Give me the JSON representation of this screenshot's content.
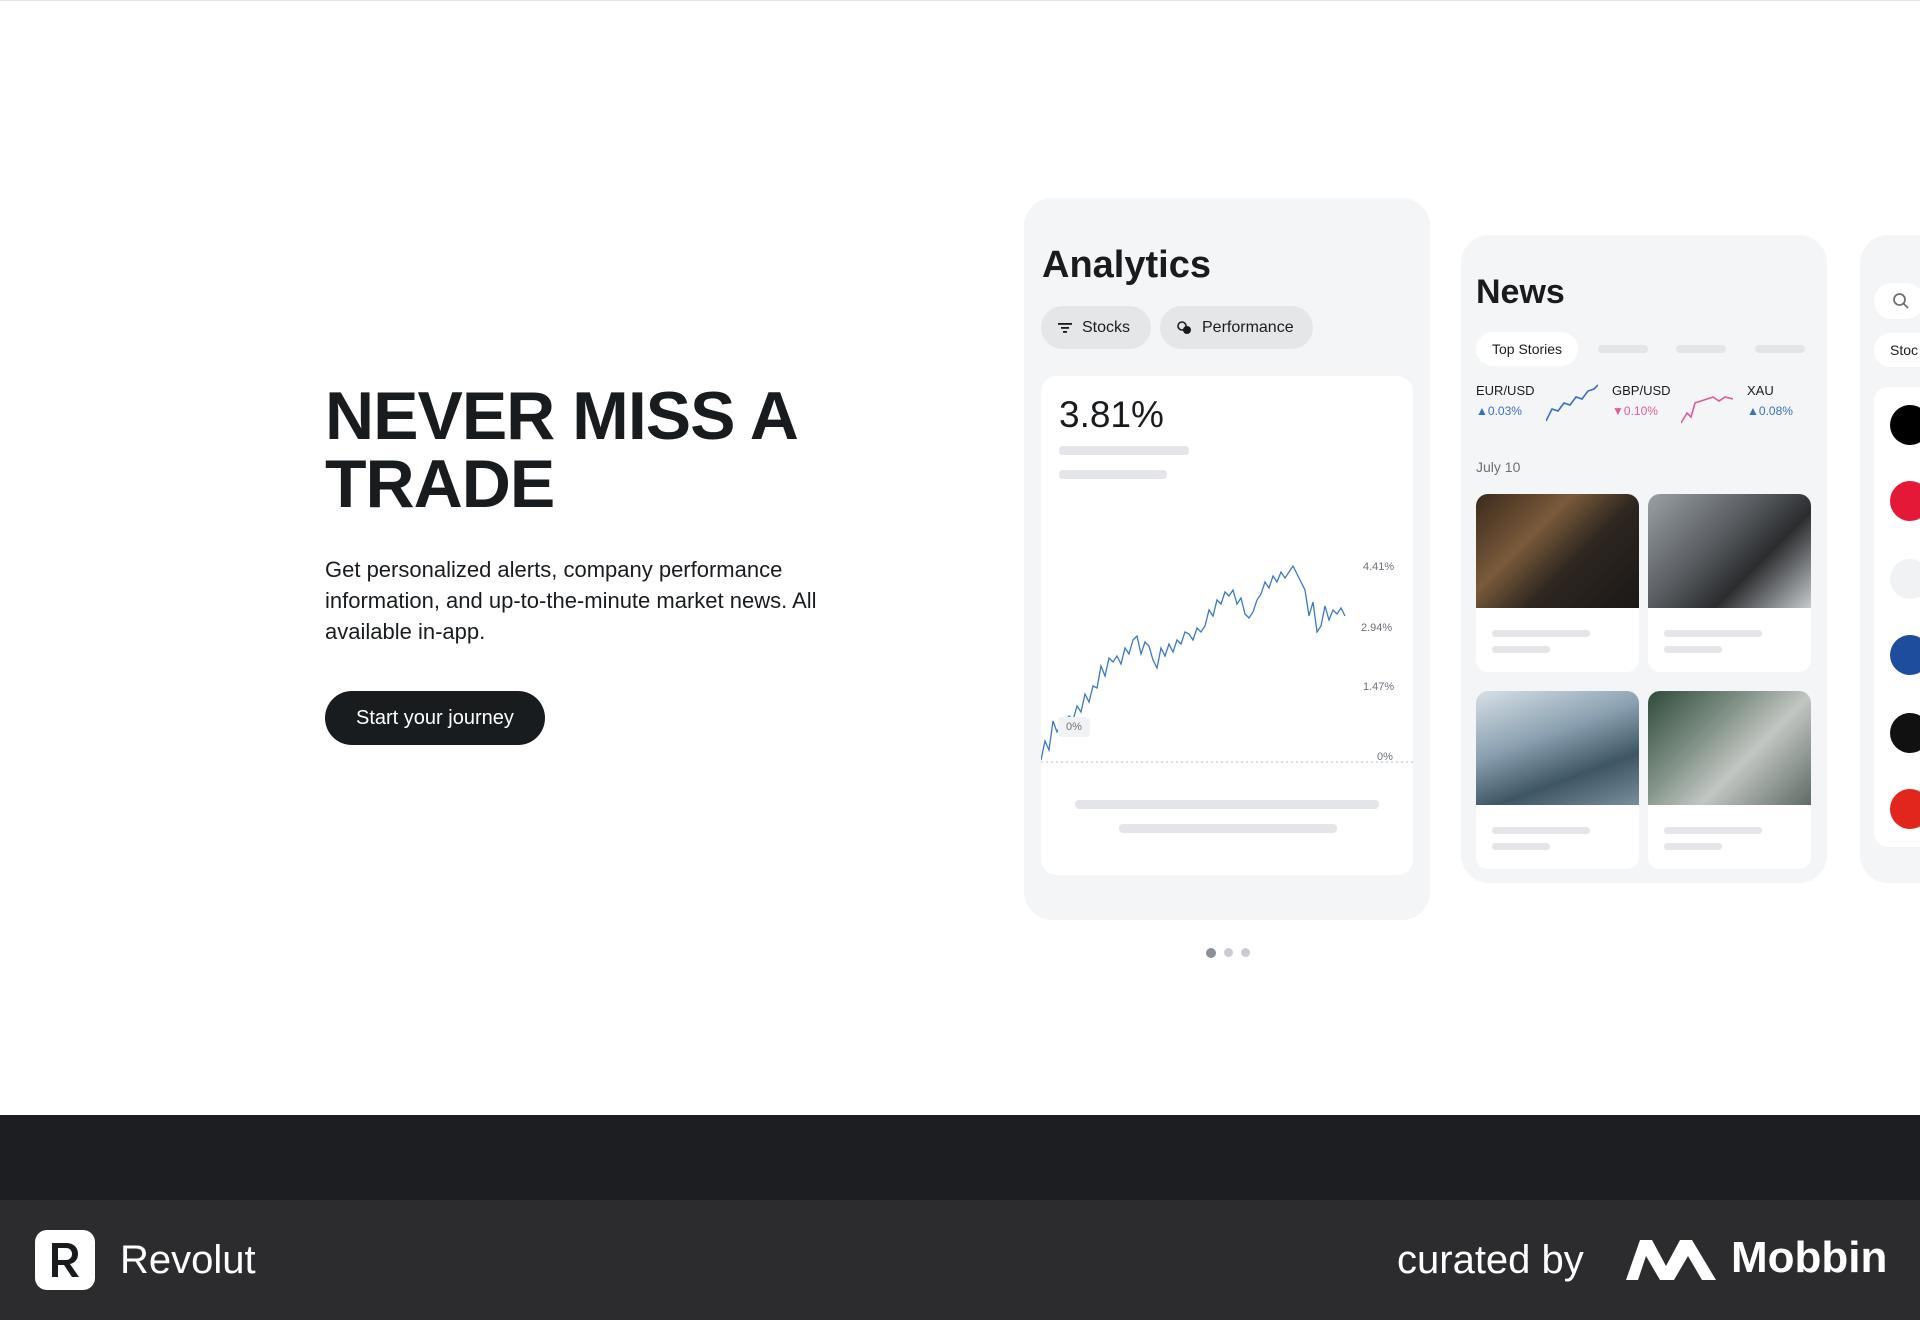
{
  "hero": {
    "title_line1": "NEVER MISS A",
    "title_line2": "TRADE",
    "description": "Get personalized alerts, company performance information, and up-to-the-minute market news. All available in-app.",
    "cta_label": "Start your journey"
  },
  "analytics_card": {
    "title": "Analytics",
    "chips": [
      "Stocks",
      "Performance"
    ],
    "headline_value": "3.81%",
    "ticks": [
      "4.41%",
      "2.94%",
      "1.47%",
      "0%"
    ],
    "baseline_badge": "0%"
  },
  "news_card": {
    "title": "News",
    "tab_active": "Top Stories",
    "fx": [
      {
        "name": "EUR/USD",
        "change": "0.03%",
        "direction": "up",
        "color": "#3a6fc4"
      },
      {
        "name": "GBP/USD",
        "change": "0.10%",
        "direction": "down",
        "color": "#e05a9a"
      },
      {
        "name": "XAU",
        "change": "0.08%",
        "direction": "up",
        "color": "#3a6fc4"
      }
    ],
    "date_label": "July 10"
  },
  "third_card": {
    "pill_label": "Stoc"
  },
  "carousel": {
    "page_count": 3,
    "active_index": 0
  },
  "footer": {
    "brand": "Revolut",
    "curated_by": "curated by",
    "curator": "Mobbin"
  },
  "icons": [
    "filter-icon",
    "performance-icon",
    "search-icon",
    "revolut-logo",
    "mobbin-logo"
  ]
}
